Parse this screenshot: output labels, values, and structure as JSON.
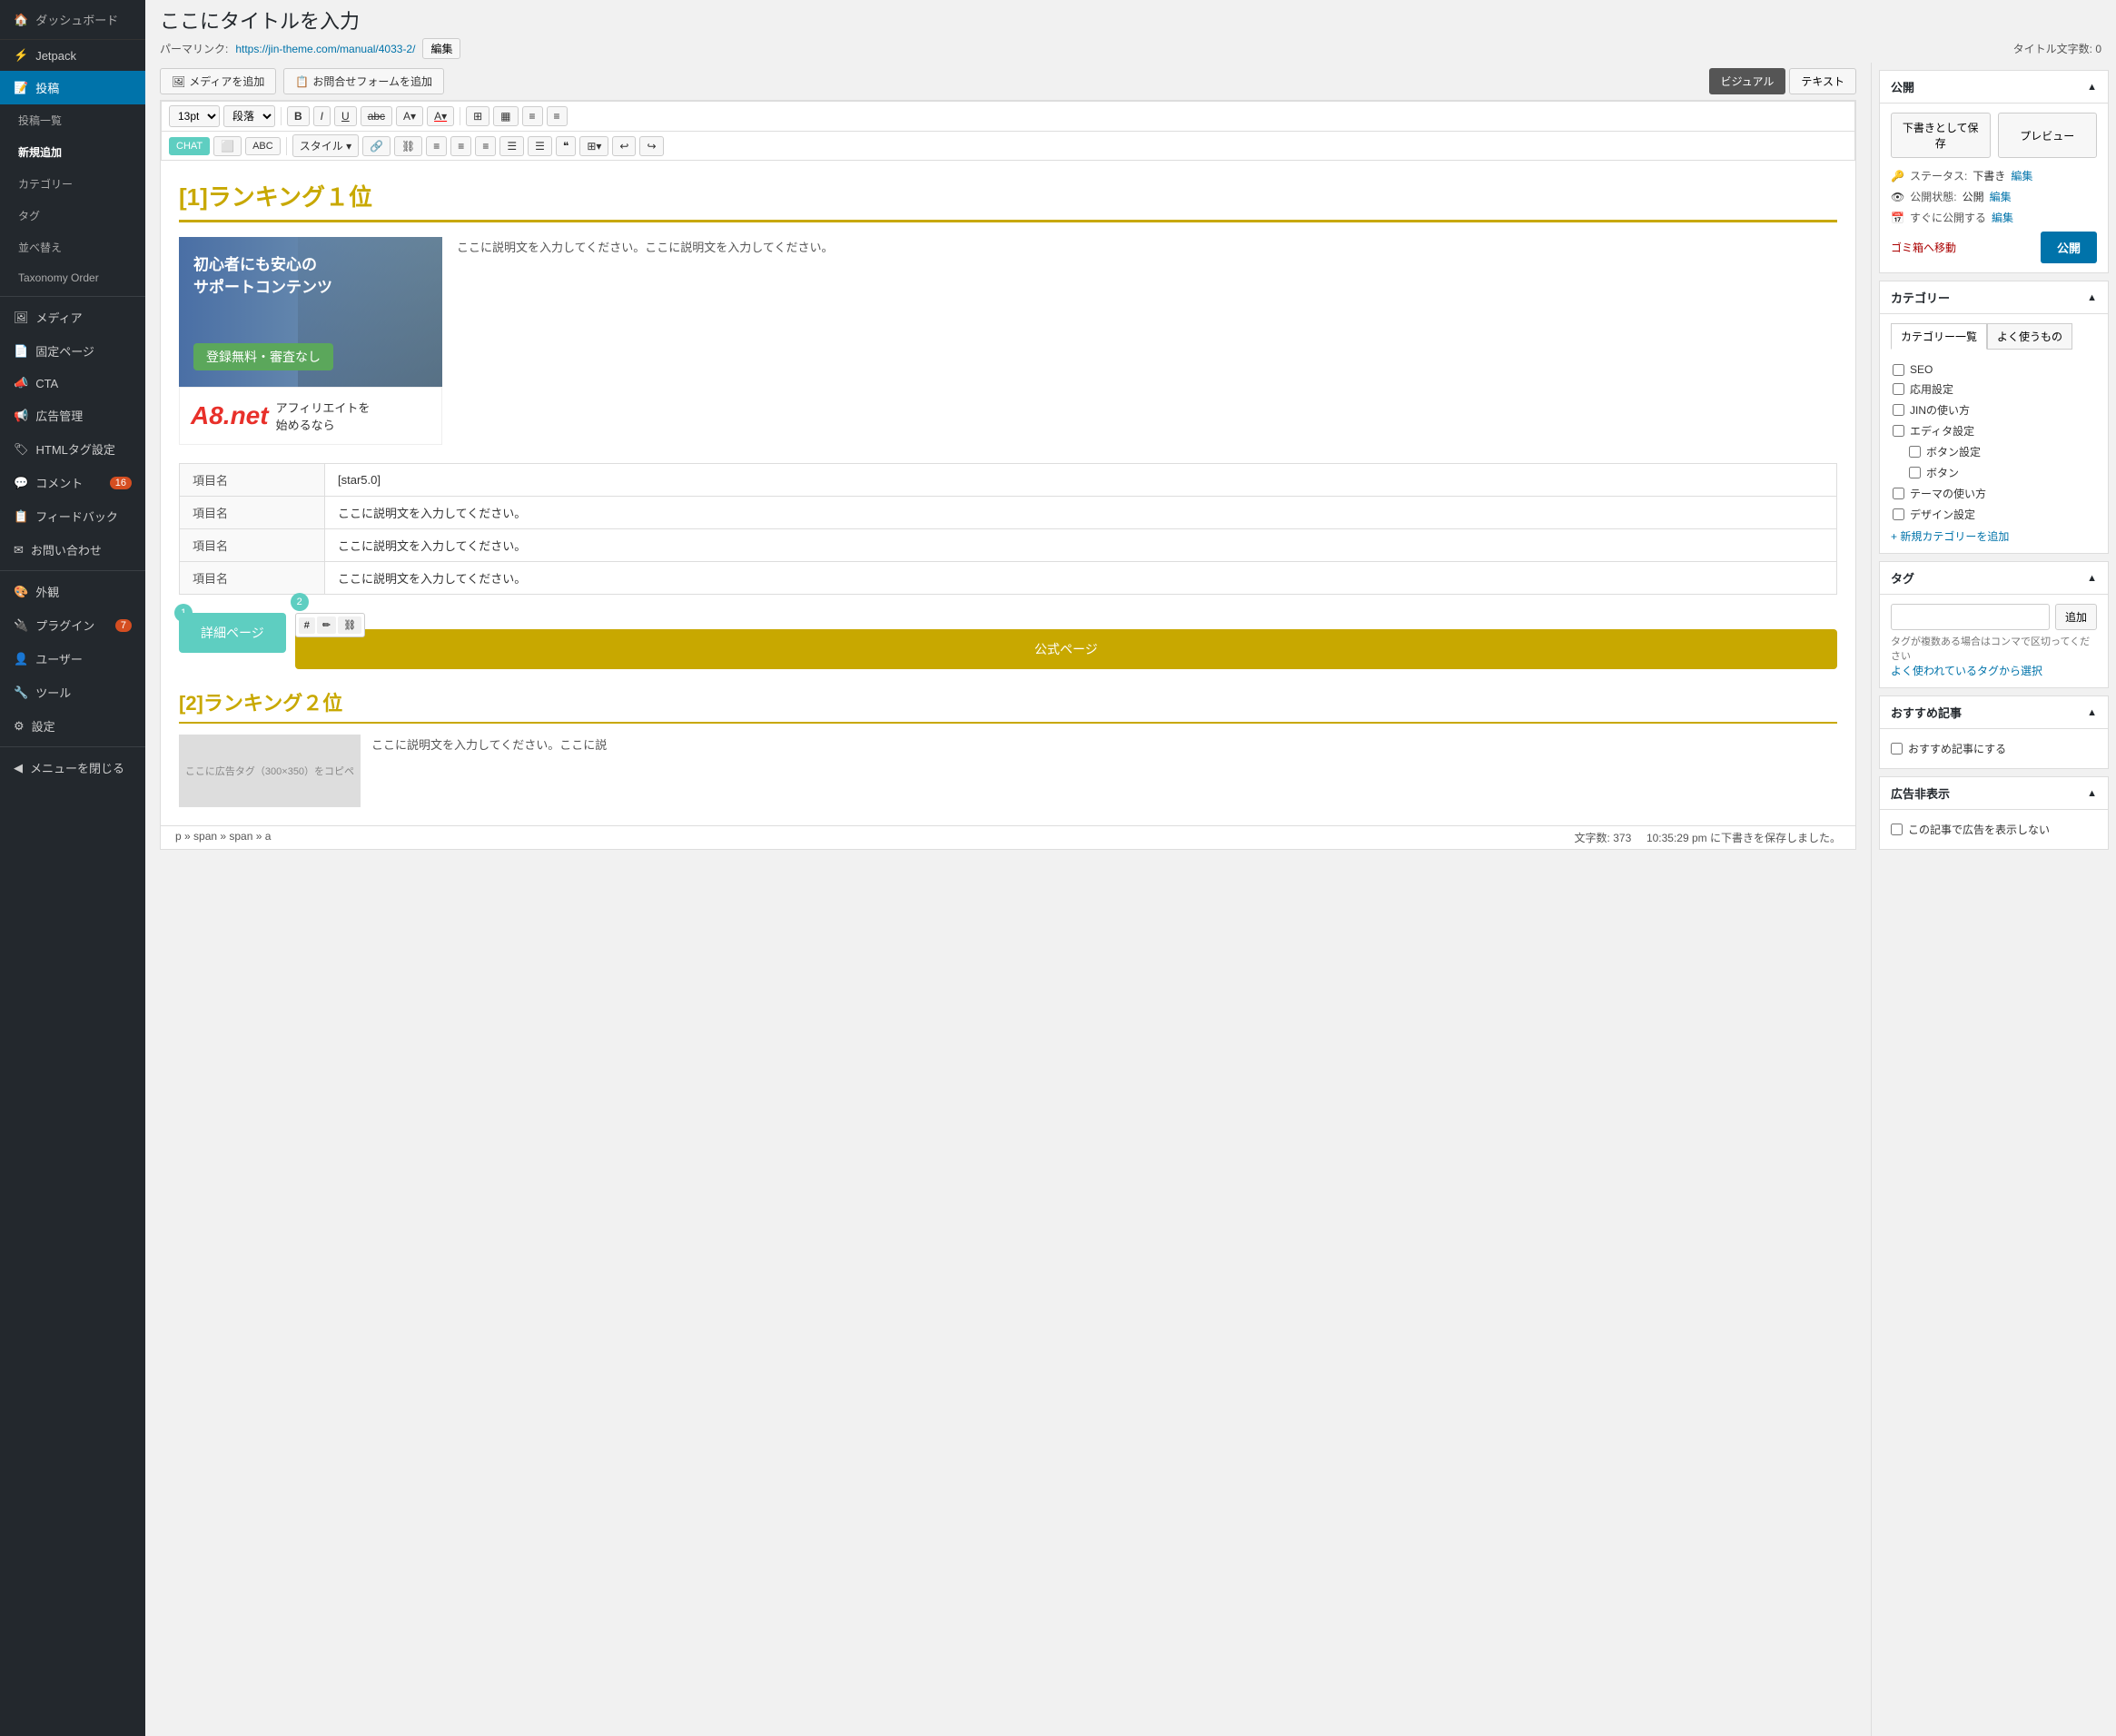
{
  "sidebar": {
    "logo": "ダッシュボード",
    "items": [
      {
        "id": "dashboard",
        "label": "ダッシュボード",
        "icon": "🏠",
        "sub": false
      },
      {
        "id": "jetpack",
        "label": "Jetpack",
        "icon": "⚡",
        "sub": false
      },
      {
        "id": "posts",
        "label": "投稿",
        "icon": "📝",
        "sub": false,
        "active": true
      },
      {
        "id": "posts-list",
        "label": "投稿一覧",
        "sub": true
      },
      {
        "id": "posts-new",
        "label": "新規追加",
        "sub": true,
        "active_sub": true
      },
      {
        "id": "categories",
        "label": "カテゴリー",
        "sub": true
      },
      {
        "id": "tags",
        "label": "タグ",
        "sub": true
      },
      {
        "id": "sort",
        "label": "並べ替え",
        "sub": true
      },
      {
        "id": "taxonomy-order",
        "label": "Taxonomy Order",
        "sub": true
      },
      {
        "id": "media",
        "label": "メディア",
        "icon": "🖼",
        "sub": false
      },
      {
        "id": "pages",
        "label": "固定ページ",
        "icon": "📄",
        "sub": false
      },
      {
        "id": "cta",
        "label": "CTA",
        "icon": "📣",
        "sub": false
      },
      {
        "id": "ads",
        "label": "広告管理",
        "icon": "📢",
        "sub": false
      },
      {
        "id": "html-tags",
        "label": "HTMLタグ設定",
        "icon": "🏷",
        "sub": false
      },
      {
        "id": "comments",
        "label": "コメント",
        "icon": "💬",
        "sub": false,
        "badge": "16"
      },
      {
        "id": "feedback",
        "label": "フィードバック",
        "icon": "📋",
        "sub": false
      },
      {
        "id": "contact",
        "label": "お問い合わせ",
        "icon": "✉",
        "sub": false
      },
      {
        "id": "appearance",
        "label": "外観",
        "icon": "🎨",
        "sub": false
      },
      {
        "id": "plugins",
        "label": "プラグイン",
        "icon": "🔌",
        "sub": false,
        "badge": "7"
      },
      {
        "id": "users",
        "label": "ユーザー",
        "icon": "👤",
        "sub": false
      },
      {
        "id": "tools",
        "label": "ツール",
        "icon": "🔧",
        "sub": false
      },
      {
        "id": "settings",
        "label": "設定",
        "icon": "⚙",
        "sub": false
      },
      {
        "id": "collapse",
        "label": "メニューを閉じる",
        "icon": "◀",
        "sub": false
      }
    ]
  },
  "page": {
    "title": "ここにタイトルを入力",
    "permalink_label": "パーマリンク:",
    "permalink_url": "https://jin-theme.com/manual/4033-2/",
    "permalink_edit": "編集",
    "char_count_label": "タイトル文字数:",
    "char_count": "0"
  },
  "toolbar": {
    "font_size": "13pt",
    "format": "段落",
    "tab_visual": "ビジュアル",
    "tab_text": "テキスト",
    "media_btn": "メディアを追加",
    "form_btn": "お問合せフォームを追加",
    "style_label": "スタイル",
    "chat_icon": "CHAT",
    "abc_icon": "ABC",
    "icons": [
      "B",
      "I",
      "U",
      "abc",
      "A▾",
      "A▾",
      "⊞",
      "▦",
      "≡",
      "≡"
    ]
  },
  "editor": {
    "heading1": "[1]ランキング１位",
    "desc1": "ここに説明文を入力してください。ここに説明文を入力してください。",
    "support_text_line1": "初心者にも安心の",
    "support_text_line2": "サポートコンテンツ",
    "register_badge": "登録無料・審査なし",
    "a8_logo": "A8.net",
    "a8_text_line1": "アフィリエイトを",
    "a8_text_line2": "始めるなら",
    "table_rows": [
      {
        "col1": "項目名",
        "col2": "[star5.0]"
      },
      {
        "col1": "項目名",
        "col2": "ここに説明文を入力してください。"
      },
      {
        "col1": "項目名",
        "col2": "ここに説明文を入力してください。"
      },
      {
        "col1": "項目名",
        "col2": "ここに説明文を入力してください。"
      }
    ],
    "btn_detail": "詳細ページ",
    "btn_official": "公式ページ",
    "btn1_badge": "1",
    "btn2_badge": "2",
    "heading2": "[2]ランキング２位",
    "desc2_start": "ここに広告タグ（300×350）をコピペ",
    "desc2_text": "ここに説明文を入力してください。ここに説"
  },
  "publish_panel": {
    "title": "公開",
    "save_draft": "下書きとして保存",
    "preview": "プレビュー",
    "status_label": "ステータス:",
    "status_value": "下書き",
    "status_edit": "編集",
    "visibility_label": "公開状態:",
    "visibility_value": "公開",
    "visibility_edit": "編集",
    "schedule_label": "すぐに公開する",
    "schedule_edit": "編集",
    "delete_link": "ゴミ箱へ移動",
    "publish_btn": "公開"
  },
  "categories_panel": {
    "title": "カテゴリー",
    "tab_all": "カテゴリー一覧",
    "tab_common": "よく使うもの",
    "items": [
      {
        "label": "SEO",
        "indent": 0
      },
      {
        "label": "応用設定",
        "indent": 0
      },
      {
        "label": "JINの使い方",
        "indent": 0
      },
      {
        "label": "エディタ設定",
        "indent": 0
      },
      {
        "label": "ボタン設定",
        "indent": 1
      },
      {
        "label": "ボタン",
        "indent": 1
      },
      {
        "label": "テーマの使い方",
        "indent": 0
      },
      {
        "label": "デザイン設定",
        "indent": 0
      }
    ],
    "add_link": "+ 新規カテゴリーを追加"
  },
  "tags_panel": {
    "title": "タグ",
    "add_btn": "追加",
    "hint": "タグが複数ある場合はコンマで区切ってください",
    "popular_link": "よく使われているタグから選択"
  },
  "recommended_panel": {
    "title": "おすすめ記事",
    "check_label": "おすすめ記事にする"
  },
  "ads_panel": {
    "title": "広告非表示",
    "check_label": "この記事で広告を表示しない"
  },
  "statusbar": {
    "breadcrumb": "p » span » span » a",
    "word_count_label": "文字数:",
    "word_count": "373",
    "save_time": "10:35:29 pm に下書きを保存しました。"
  }
}
